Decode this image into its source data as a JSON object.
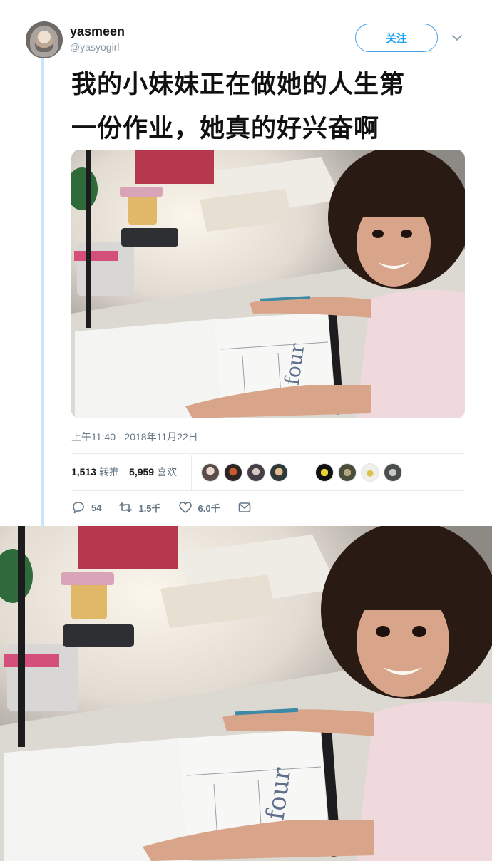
{
  "user": {
    "name": "yasmeen",
    "handle": "@yasyogirl"
  },
  "follow_label": "关注",
  "tweet": {
    "line1": "我的小妹妹正在做她的人生第",
    "line2": "一份作业，她真的好兴奋啊",
    "timestamp": "上午11:40 - 2018年11月22日"
  },
  "stats": {
    "retweets_count": "1,513",
    "retweets_label": "转推",
    "likes_count": "5,959",
    "likes_label": "喜欢"
  },
  "actions": {
    "replies": "54",
    "retweets": "1.5千",
    "likes": "6.0千"
  },
  "icons": [
    "chevron-down-icon",
    "reply-icon",
    "retweet-icon",
    "like-icon",
    "message-icon"
  ],
  "colors": {
    "accent": "#1da1f2",
    "thread_line": "#c9e6f9",
    "muted": "#657786"
  }
}
